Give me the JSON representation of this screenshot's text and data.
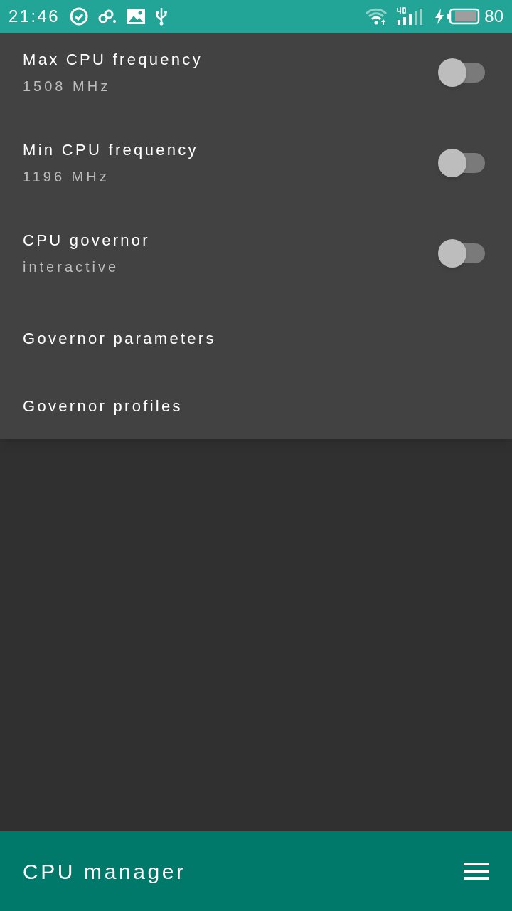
{
  "status_bar": {
    "time": "21:46",
    "battery": "80"
  },
  "settings": [
    {
      "kind": "switch",
      "title": "Max CPU frequency",
      "summary": "1508 MHz",
      "on": false
    },
    {
      "kind": "switch",
      "title": "Min CPU frequency",
      "summary": "1196 MHz",
      "on": false
    },
    {
      "kind": "switch",
      "title": "CPU governor",
      "summary": "interactive",
      "on": false
    },
    {
      "kind": "link",
      "title": "Governor parameters"
    },
    {
      "kind": "link",
      "title": "Governor profiles"
    }
  ],
  "bottom_bar": {
    "title": "CPU manager"
  }
}
